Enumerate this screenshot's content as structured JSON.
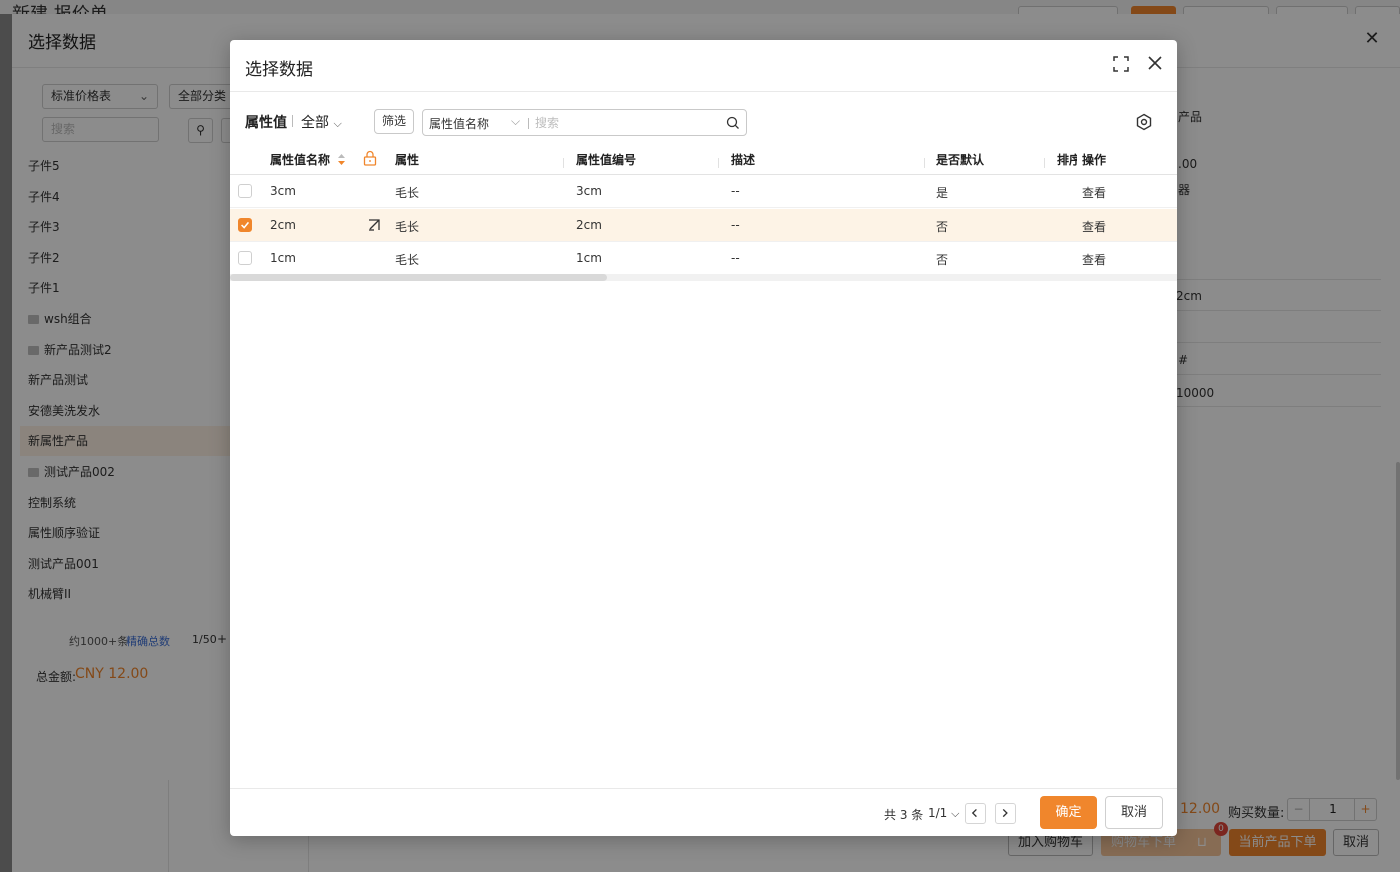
{
  "background": {
    "page_title": "新建 报价单",
    "panel_title": "选择数据",
    "price_table": "标准价格表",
    "all_categories": "全部分类",
    "search_placeholder": "搜索",
    "side_items": [
      "子件5",
      "子件4",
      "子件3",
      "子件2",
      "子件1",
      "wsh组合",
      "新产品测试2",
      "新产品测试",
      "安德美洗发水",
      "新属性产品",
      "测试产品002",
      "控制系统",
      "属性顺序验证",
      "测试产品001",
      "机械臂II"
    ],
    "approx_count": "约1000+条",
    "exact_total": "精确总数",
    "page_info": "1/50",
    "total_label": "总金额:",
    "total_value": "CNY 12.00",
    "right_texts": [
      "产品",
      ".00",
      "器",
      "2cm",
      "#",
      "10000"
    ],
    "price_partial": "12.00",
    "qty_label": "购买数量:",
    "qty_value": "1",
    "add_cart": "加入购物车",
    "cart_order": "购物车下单",
    "cart_badge": "0",
    "order_now": "当前产品下单",
    "cancel": "取消"
  },
  "modal": {
    "title": "选择数据",
    "filter_label": "属性值",
    "filter_value": "全部",
    "filter_button": "筛选",
    "search_field": "属性值名称",
    "search_placeholder": "搜索",
    "columns": [
      "属性值名称",
      "属性",
      "属性值编号",
      "描述",
      "是否默认",
      "排序",
      "操作"
    ],
    "rows": [
      {
        "name": "3cm",
        "attr": "毛长",
        "code": "3cm",
        "desc": "--",
        "default": "是",
        "action": "查看",
        "selected": false
      },
      {
        "name": "2cm",
        "attr": "毛长",
        "code": "2cm",
        "desc": "--",
        "default": "否",
        "action": "查看",
        "selected": true
      },
      {
        "name": "1cm",
        "attr": "毛长",
        "code": "1cm",
        "desc": "--",
        "default": "否",
        "action": "查看",
        "selected": false
      }
    ],
    "total": "共 3 条",
    "pager": "1/1",
    "confirm": "确定",
    "cancel": "取消"
  },
  "colors": {
    "accent": "#f0862c",
    "link": "#3c6fd8"
  }
}
